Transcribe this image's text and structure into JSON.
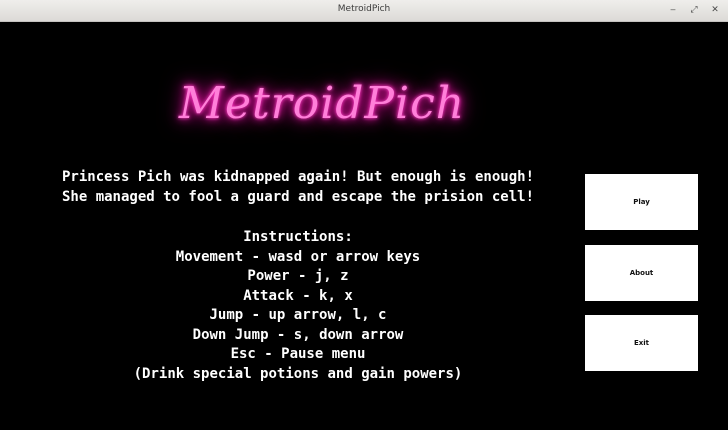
{
  "window": {
    "title": "MetroidPich",
    "controls": [
      {
        "name": "minimize-icon",
        "glyph": "‒"
      },
      {
        "name": "maximize-icon",
        "glyph": "⤢"
      },
      {
        "name": "close-icon",
        "glyph": "✕"
      }
    ]
  },
  "game": {
    "logo": "MetroidPich",
    "logo_color": "#ff1fb5",
    "background_color": "#000000",
    "story": [
      "Princess Pich was kidnapped again! But enough is enough!",
      "She managed to fool a guard and escape the prision cell!"
    ],
    "instructions": [
      "Instructions:",
      "Movement - wasd or arrow keys",
      "Power - j, z",
      "Attack - k, x",
      "Jump - up arrow, l, c",
      "Down Jump - s, down arrow",
      "Esc - Pause menu",
      "(Drink special potions and gain powers)"
    ],
    "menu": {
      "play_label": "Play",
      "about_label": "About",
      "exit_label": "Exit"
    }
  }
}
